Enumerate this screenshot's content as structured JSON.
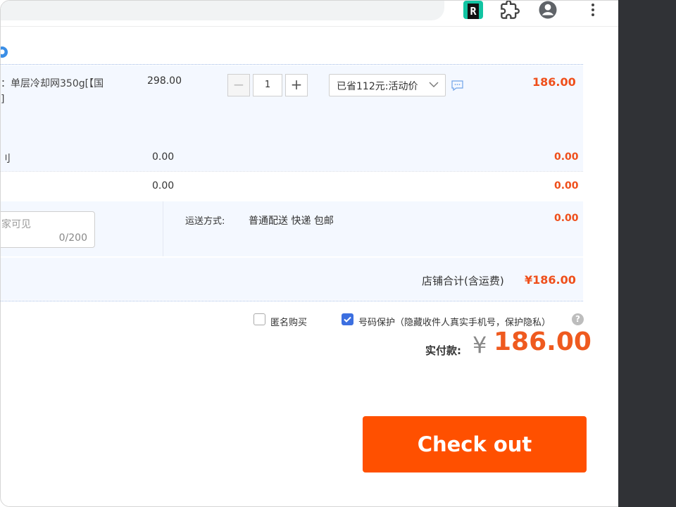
{
  "browser": {
    "extension_icon": "R",
    "icons": [
      "r-extension-icon",
      "puzzle-icon",
      "account-icon",
      "more-vert-icon"
    ]
  },
  "order": {
    "item": {
      "spec_line1": "：单层冷却网350g[【国",
      "spec_line2": "]",
      "unit_price": "298.00",
      "quantity": "1",
      "promo_select": "已省112元:活动价",
      "subtotal": "186.00"
    },
    "extra_row1": {
      "label": "刂",
      "price": "0.00",
      "total": "0.00"
    },
    "extra_row2": {
      "price": "0.00",
      "total": "0.00"
    },
    "memo": {
      "placeholder": "家可见",
      "counter": "0/200"
    },
    "shipping": {
      "label": "运送方式:",
      "method": "普通配送 快递 包邮",
      "fee": "0.00"
    },
    "shop_total": {
      "label": "店铺合计(含运费)",
      "amount": "¥186.00"
    }
  },
  "options": {
    "anonymous": {
      "label": "匿名购买",
      "checked": false
    },
    "number_protect": {
      "label": "号码保护（隐藏收件人真实手机号，保护隐私）",
      "checked": true
    }
  },
  "payment": {
    "label": "实付款:",
    "currency": "¥",
    "amount": "186.00"
  },
  "checkout_button": "Check out",
  "colors": {
    "accent": "#ff5000",
    "price_red": "#ef4f1b",
    "row_bg": "#f4f8ff",
    "checkbox_blue": "#3c6fe0"
  }
}
